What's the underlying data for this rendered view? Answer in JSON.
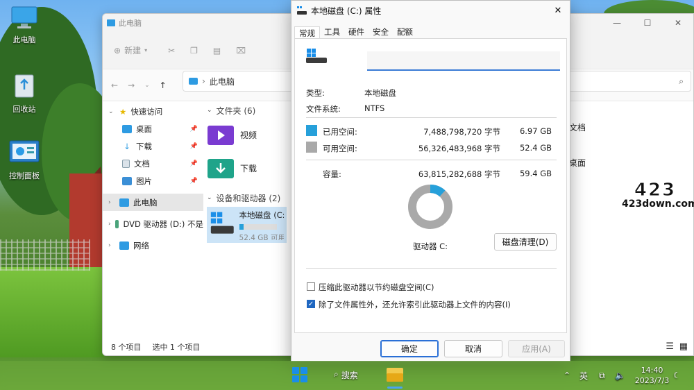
{
  "desktop": {
    "icons": [
      {
        "label": "此电脑"
      },
      {
        "label": "回收站"
      },
      {
        "label": "控制面板"
      }
    ]
  },
  "explorer": {
    "title": "此电脑",
    "toolbar": {
      "new_label": "新建"
    },
    "address": {
      "path": "此电脑"
    },
    "nav": {
      "quick_access": "快速访问",
      "items": [
        "桌面",
        "下载",
        "文档",
        "图片"
      ],
      "this_pc": "此电脑",
      "dvd": "DVD 驱动器 (D:) 不是",
      "network": "网络"
    },
    "folders_header": "文件夹 (6)",
    "folders": [
      "视频",
      "下载"
    ],
    "right_folders": [
      "文档",
      "桌面"
    ],
    "devices_header": "设备和驱动器 (2)",
    "drive": {
      "name": "本地磁盘 (C:)",
      "free_text": "52.4 GB 可用",
      "used_fraction": 0.117
    },
    "status": {
      "count": "8 个项目",
      "selected": "选中 1 个项目"
    }
  },
  "dialog": {
    "title": "本地磁盘 (C:) 属性",
    "tabs": [
      "常规",
      "工具",
      "硬件",
      "安全",
      "配额"
    ],
    "name_value": "",
    "type_label": "类型:",
    "type_value": "本地磁盘",
    "fs_label": "文件系统:",
    "fs_value": "NTFS",
    "used_label": "已用空间:",
    "used_bytes": "7,488,798,720 字节",
    "used_gb": "6.97 GB",
    "free_label": "可用空间:",
    "free_bytes": "56,326,483,968 字节",
    "free_gb": "52.4 GB",
    "cap_label": "容量:",
    "cap_bytes": "63,815,282,688 字节",
    "cap_gb": "59.4 GB",
    "drive_label": "驱动器 C:",
    "cleanup_button": "磁盘清理(D)",
    "compress_label": "压缩此驱动器以节约磁盘空间(C)",
    "compress_checked": false,
    "index_label": "除了文件属性外，还允许索引此驱动器上文件的内容(I)",
    "index_checked": true,
    "ok": "确定",
    "cancel": "取消",
    "apply": "应用(A)",
    "used_color": "#26a0da",
    "free_color": "#a9a9a9",
    "used_fraction": 0.1173
  },
  "watermark": {
    "big": "423",
    "small": "423down.com"
  },
  "taskbar": {
    "search_label": "搜索",
    "ime": "英",
    "time": "14:40",
    "date": "2023/7/3"
  }
}
